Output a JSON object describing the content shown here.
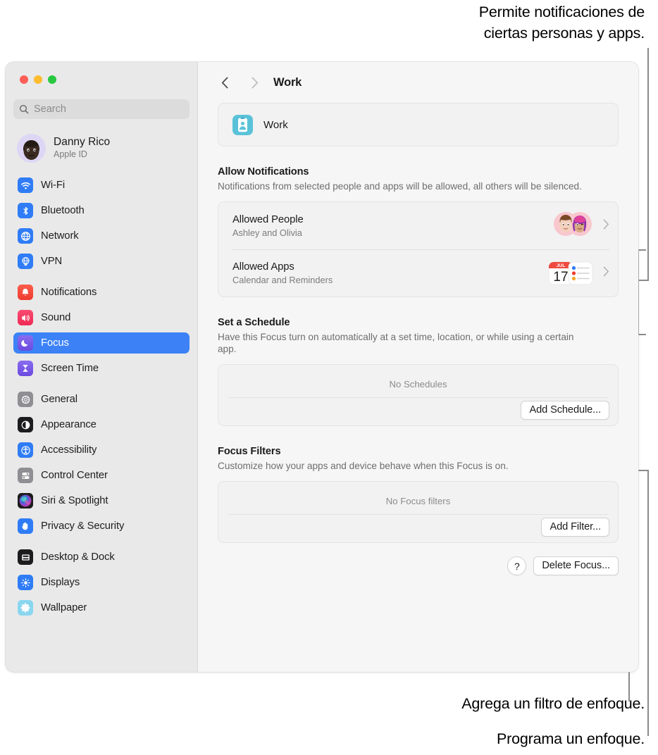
{
  "callouts": {
    "top": "Permite notificaciones de\nciertas personas y apps.",
    "filter": "Agrega un filtro de enfoque.",
    "schedule": "Programa un enfoque."
  },
  "window": {
    "traffic_lights": [
      "close",
      "minimize",
      "zoom"
    ]
  },
  "sidebar": {
    "search": {
      "placeholder": "Search",
      "icon": "search-icon"
    },
    "account": {
      "name": "Danny Rico",
      "subtitle": "Apple ID",
      "avatar": "memoji-avatar"
    },
    "groups": [
      {
        "items": [
          {
            "label": "Wi-Fi",
            "icon": "wifi-icon"
          },
          {
            "label": "Bluetooth",
            "icon": "bluetooth-icon"
          },
          {
            "label": "Network",
            "icon": "network-icon"
          },
          {
            "label": "VPN",
            "icon": "vpn-icon"
          }
        ]
      },
      {
        "items": [
          {
            "label": "Notifications",
            "icon": "bell-icon"
          },
          {
            "label": "Sound",
            "icon": "speaker-icon"
          },
          {
            "label": "Focus",
            "icon": "moon-icon",
            "selected": true
          },
          {
            "label": "Screen Time",
            "icon": "hourglass-icon"
          }
        ]
      },
      {
        "items": [
          {
            "label": "General",
            "icon": "gear-icon"
          },
          {
            "label": "Appearance",
            "icon": "appearance-icon"
          },
          {
            "label": "Accessibility",
            "icon": "accessibility-icon"
          },
          {
            "label": "Control Center",
            "icon": "control-center-icon"
          },
          {
            "label": "Siri & Spotlight",
            "icon": "siri-icon"
          },
          {
            "label": "Privacy & Security",
            "icon": "hand-icon"
          }
        ]
      },
      {
        "items": [
          {
            "label": "Desktop & Dock",
            "icon": "desktop-dock-icon"
          },
          {
            "label": "Displays",
            "icon": "displays-icon"
          },
          {
            "label": "Wallpaper",
            "icon": "wallpaper-icon"
          }
        ]
      }
    ]
  },
  "toolbar": {
    "back_icon": "chevron-left-icon",
    "forward_icon": "chevron-right-icon",
    "title": "Work"
  },
  "main": {
    "focus_card": {
      "name": "Work",
      "icon": "work-badge-icon"
    },
    "allow_notifications": {
      "title": "Allow Notifications",
      "description": "Notifications from selected people and apps will be allowed, all others will be silenced.",
      "rows": [
        {
          "title": "Allowed People",
          "subtitle": "Ashley and Olivia",
          "accessory": "memoji-pair-icon"
        },
        {
          "title": "Allowed Apps",
          "subtitle": "Calendar and Reminders",
          "accessory": "calendar-reminders-icon"
        }
      ]
    },
    "schedule": {
      "title": "Set a Schedule",
      "description": "Have this Focus turn on automatically at a set time, location, or while using a certain app.",
      "empty_label": "No Schedules",
      "add_button": "Add Schedule..."
    },
    "filters": {
      "title": "Focus Filters",
      "description": "Customize how your apps and device behave when this Focus is on.",
      "empty_label": "No Focus filters",
      "add_button": "Add Filter..."
    },
    "footer": {
      "help_label": "?",
      "delete_button": "Delete Focus..."
    }
  },
  "calendar_icon": {
    "month": "JUL",
    "day": "17"
  },
  "colors": {
    "accent": "#3c82f6",
    "sidebar_bg": "#e9e9e9",
    "content_bg": "#f6f6f6",
    "card_bg": "#f2f2f2",
    "work_badge": "#5ac2d8",
    "leader_line": "#8a8a8a"
  }
}
